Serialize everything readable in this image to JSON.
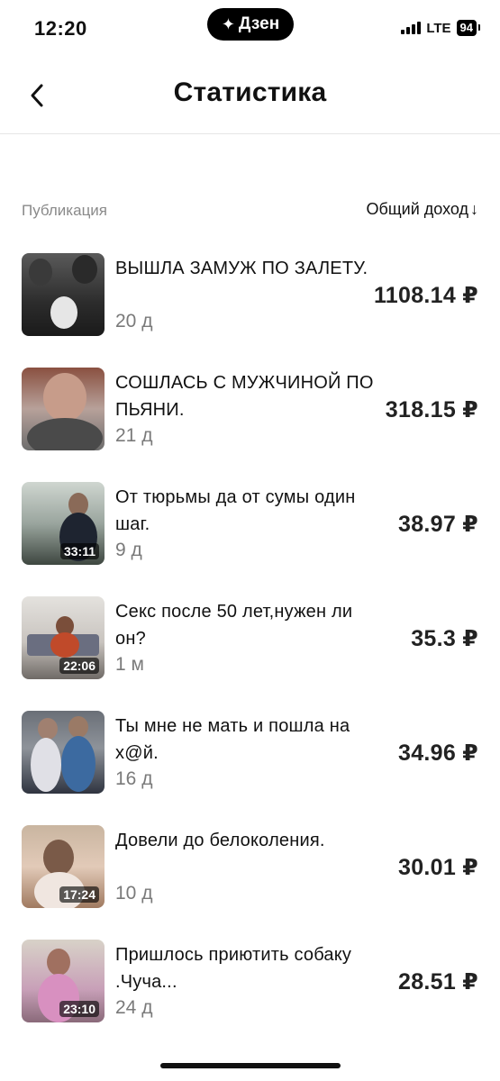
{
  "status_bar": {
    "time": "12:20",
    "app_pill": "Дзен",
    "network": "LTE",
    "battery": "94"
  },
  "header": {
    "title": "Статистика"
  },
  "columns": {
    "left": "Публикация",
    "right": "Общий доход"
  },
  "items": [
    {
      "title": "ВЫШЛА ЗАМУЖ ПО ЗАЛЕТУ.",
      "age": "20 д",
      "income": "1108.14 ₽",
      "duration": ""
    },
    {
      "title": "СОШЛАСЬ С МУЖЧИНОЙ ПО ПЬЯНИ.",
      "age": "21 д",
      "income": "318.15 ₽",
      "duration": ""
    },
    {
      "title": "От тюрьмы да от сумы один шаг.",
      "age": "9 д",
      "income": "38.97 ₽",
      "duration": "33:11"
    },
    {
      "title": "Секс после 50 лет,нужен ли он?",
      "age": "1 м",
      "income": "35.3 ₽",
      "duration": "22:06"
    },
    {
      "title": "Ты мне не мать и пошла на х@й.",
      "age": "16 д",
      "income": "34.96 ₽",
      "duration": ""
    },
    {
      "title": "Довели до белоколения.",
      "age": "10 д",
      "income": "30.01 ₽",
      "duration": "17:24"
    },
    {
      "title": "Пришлось приютить собаку .Чуча...",
      "age": "24 д",
      "income": "28.51 ₽",
      "duration": "23:10"
    }
  ]
}
